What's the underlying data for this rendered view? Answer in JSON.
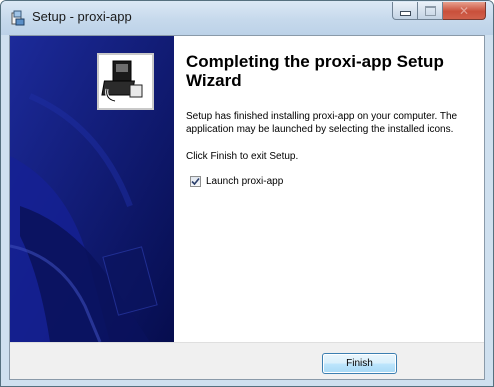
{
  "window": {
    "title": "Setup - proxi-app",
    "app_icon": "setup-app-icon",
    "caption_buttons": [
      "minimize-icon",
      "maximize-icon",
      "close-icon"
    ]
  },
  "wizard": {
    "side_image": "setup-wizard-banner",
    "badge_icon": "setup-computer-icon",
    "heading": "Completing the proxi-app Setup Wizard",
    "body": "Setup has finished installing proxi-app on your computer. The application may be launched by selecting the installed icons.",
    "exit_instruction": "Click Finish to exit Setup.",
    "launch_checkbox": {
      "label": "Launch proxi-app",
      "checked": true
    }
  },
  "footer": {
    "finish_label": "Finish"
  },
  "colors": {
    "side_panel": "#0f1a7f",
    "titlebar": "#c6d9ec",
    "close_button": "#c9503b",
    "button_border": "#3c7fb1"
  }
}
